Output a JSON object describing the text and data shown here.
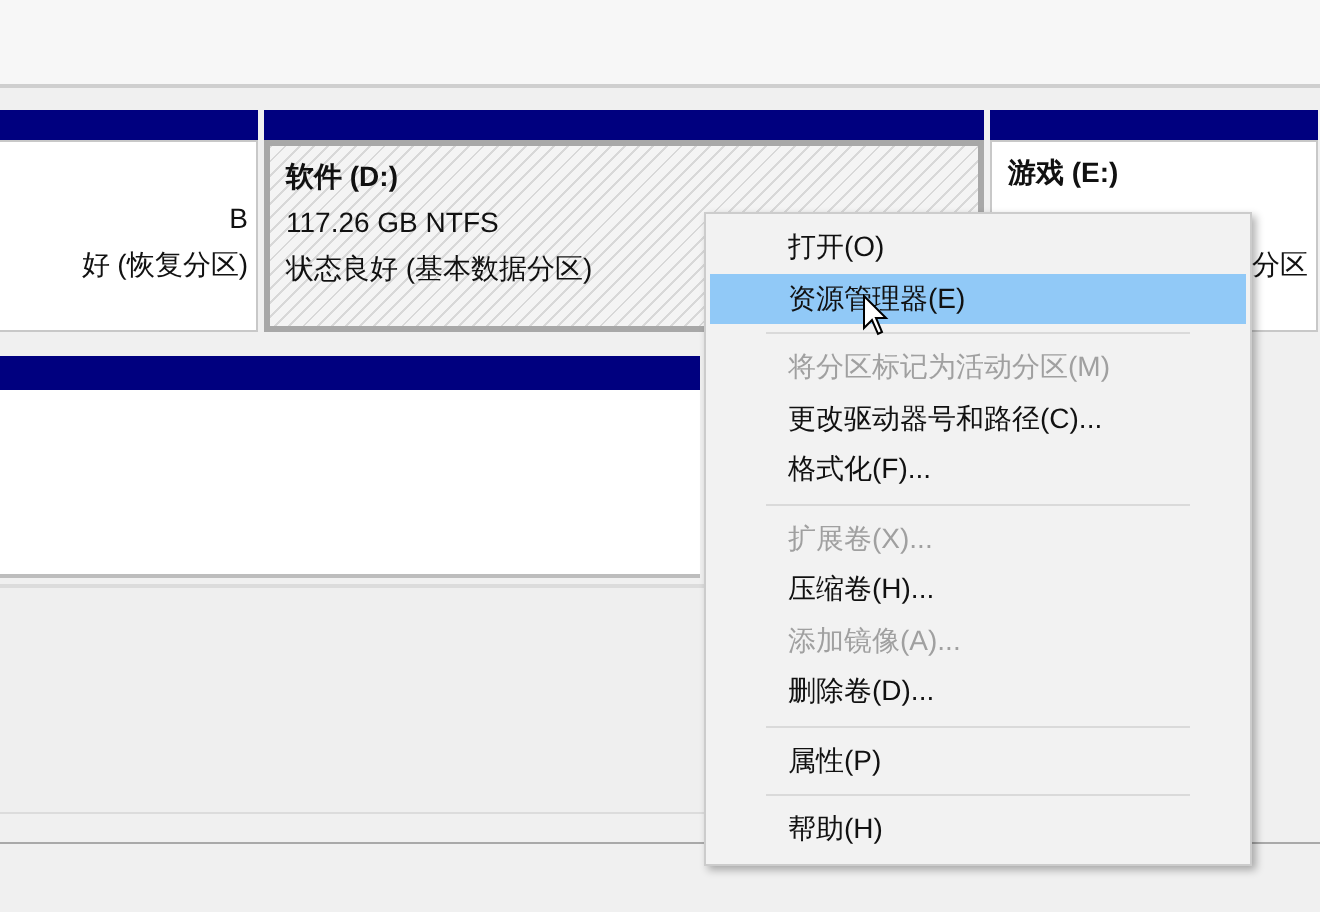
{
  "partitions": [
    {
      "lines": [
        "B",
        "好 (恢复分区)"
      ],
      "selected": false
    },
    {
      "title": "软件 (D:)",
      "lines": [
        "117.26 GB NTFS",
        "状态良好 (基本数据分区)"
      ],
      "selected": true
    },
    {
      "title": "游戏 (E:)",
      "lines": [
        "分区"
      ],
      "selected": false
    }
  ],
  "context_menu": [
    {
      "kind": "item",
      "label": "打开(O)",
      "disabled": false,
      "selected": false
    },
    {
      "kind": "item",
      "label": "资源管理器(E)",
      "disabled": false,
      "selected": true
    },
    {
      "kind": "separator"
    },
    {
      "kind": "item",
      "label": "将分区标记为活动分区(M)",
      "disabled": true,
      "selected": false
    },
    {
      "kind": "item",
      "label": "更改驱动器号和路径(C)...",
      "disabled": false,
      "selected": false
    },
    {
      "kind": "item",
      "label": "格式化(F)...",
      "disabled": false,
      "selected": false
    },
    {
      "kind": "separator"
    },
    {
      "kind": "item",
      "label": "扩展卷(X)...",
      "disabled": true,
      "selected": false
    },
    {
      "kind": "item",
      "label": "压缩卷(H)...",
      "disabled": false,
      "selected": false
    },
    {
      "kind": "item",
      "label": "添加镜像(A)...",
      "disabled": true,
      "selected": false
    },
    {
      "kind": "item",
      "label": "删除卷(D)...",
      "disabled": false,
      "selected": false
    },
    {
      "kind": "separator"
    },
    {
      "kind": "item",
      "label": "属性(P)",
      "disabled": false,
      "selected": false
    },
    {
      "kind": "separator"
    },
    {
      "kind": "item",
      "label": "帮助(H)",
      "disabled": false,
      "selected": false
    }
  ]
}
